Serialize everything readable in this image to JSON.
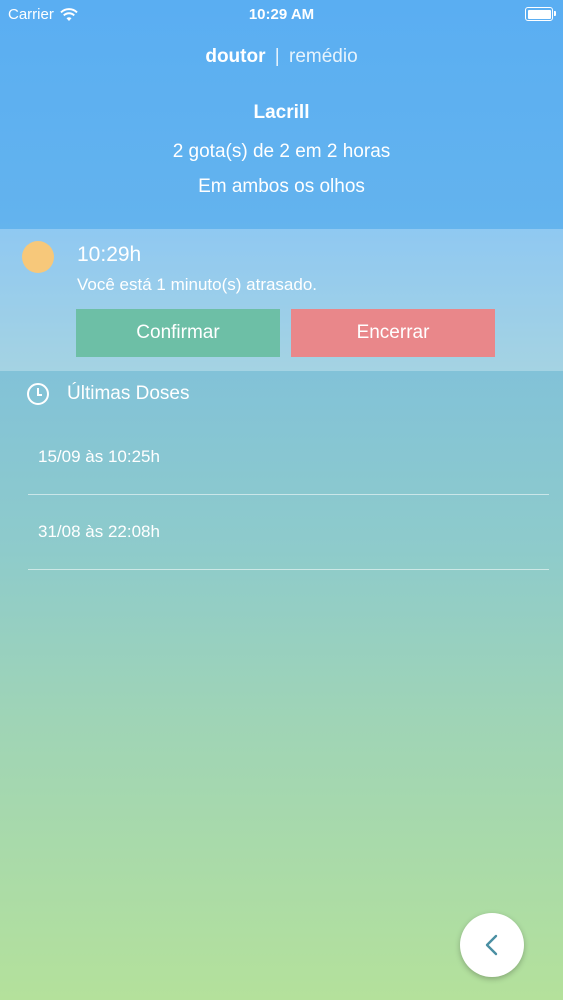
{
  "status_bar": {
    "carrier": "Carrier",
    "time": "10:29 AM"
  },
  "nav": {
    "brand": "doutor",
    "separator": "|",
    "section": "remédio"
  },
  "medicine": {
    "name": "Lacrill",
    "dosage": "2 gota(s) de 2 em 2 horas",
    "instructions": "Em ambos os olhos"
  },
  "reminder": {
    "time": "10:29h",
    "status": "Você está 1 minuto(s) atrasado.",
    "confirm_label": "Confirmar",
    "end_label": "Encerrar"
  },
  "last_doses": {
    "title": "Últimas Doses",
    "items": [
      {
        "label": "15/09 às 10:25h"
      },
      {
        "label": "31/08 às 22:08h"
      }
    ]
  },
  "colors": {
    "confirm": "#6dbfa6",
    "end": "#e9878a",
    "sun": "#f7c87a",
    "back_arrow": "#4a8fa3"
  },
  "icons": {
    "wifi": "wifi-icon",
    "battery": "battery-icon",
    "sun": "sun-icon",
    "clock": "clock-icon",
    "back": "chevron-left-icon"
  }
}
